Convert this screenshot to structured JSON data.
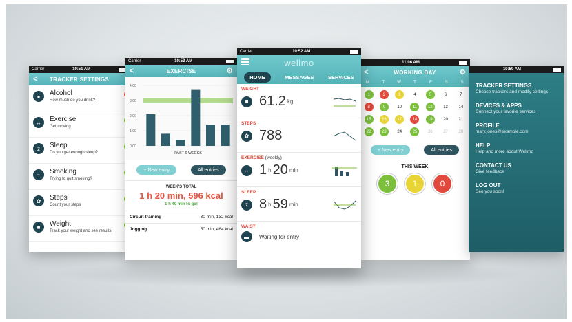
{
  "phone1": {
    "carrier": "Carrier",
    "time": "10:51 AM",
    "title": "TRACKER SETTINGS",
    "back": "<",
    "items": [
      {
        "icon": "alcohol-icon",
        "glyph": "●",
        "name": "Alcohol",
        "sub": "How much do you drink?",
        "toggle": "#e0493b"
      },
      {
        "icon": "exercise-icon",
        "glyph": "↔",
        "name": "Exercise",
        "sub": "Get moving",
        "toggle": "#7cbf3c"
      },
      {
        "icon": "sleep-icon",
        "glyph": "z",
        "name": "Sleep",
        "sub": "Do you get enough sleep?",
        "toggle": "#7cbf3c"
      },
      {
        "icon": "smoking-icon",
        "glyph": "~",
        "name": "Smoking",
        "sub": "Trying to quit smoking?",
        "toggle": "#7cbf3c"
      },
      {
        "icon": "steps-icon",
        "glyph": "✿",
        "name": "Steps",
        "sub": "Count your steps",
        "toggle": "#7cbf3c"
      },
      {
        "icon": "weight-icon",
        "glyph": "■",
        "name": "Weight",
        "sub": "Track your weight and see results!",
        "toggle": "#7cbf3c"
      }
    ]
  },
  "phone2": {
    "carrier": "Carrier",
    "time": "10:53 AM",
    "title": "EXERCISE",
    "chart_caption": "PAST 6 WEEKS",
    "new_entry": "+  New entry",
    "all_entries": "All entries",
    "weeks_total_label": "WEEK'S TOTAL",
    "weeks_total_value": "1 h 20 min, 596 kcal",
    "to_go": "1 h 40 min to go!",
    "entries": [
      {
        "name": "Circuit training",
        "value": "30 min, 132 kcal"
      },
      {
        "name": "Jogging",
        "value": "50 min, 464 kcal"
      }
    ]
  },
  "chart_data": {
    "type": "bar",
    "categories": [
      "1",
      "2",
      "3",
      "4",
      "5",
      "6"
    ],
    "values": [
      2.1,
      0.8,
      0.4,
      3.7,
      1.4,
      1.4
    ],
    "ylim": [
      0,
      4
    ],
    "yticks": [
      "4:00",
      "3:00",
      "2:00",
      "1:00",
      "0:00"
    ],
    "target": 3,
    "title": "",
    "xlabel": "PAST 6 WEEKS",
    "ylabel": ""
  },
  "phone3": {
    "carrier": "Carrier",
    "time": "10:52 AM",
    "logo": "wellmo",
    "tabs": [
      "HOME",
      "MESSAGES",
      "SERVICES"
    ],
    "metrics": [
      {
        "label": "WEIGHT",
        "icon": "weight-icon",
        "glyph": "■",
        "value": "61.2",
        "unit": "kg"
      },
      {
        "label": "STEPS",
        "icon": "steps-icon",
        "glyph": "✿",
        "value": "788",
        "unit": ""
      },
      {
        "label": "EXERCISE",
        "label2": "(weekly)",
        "icon": "exercise-icon",
        "glyph": "↔",
        "value": "1",
        "unit": "h",
        "value2": "20",
        "unit2": "min"
      },
      {
        "label": "SLEEP",
        "icon": "sleep-icon",
        "glyph": "z",
        "value": "8",
        "unit": "h",
        "value2": "59",
        "unit2": "min"
      }
    ],
    "waist_label": "WAIST",
    "waist_status": "Waiting for entry"
  },
  "phone4": {
    "time": "11:06 AM",
    "title": "WORKING DAY",
    "back": "<",
    "dow": [
      "M",
      "T",
      "W",
      "T",
      "F",
      "S",
      "S"
    ],
    "days": [
      {
        "d": "1",
        "c": "g"
      },
      {
        "d": "2",
        "c": "r"
      },
      {
        "d": "3",
        "c": "y"
      },
      {
        "d": "4",
        "c": ""
      },
      {
        "d": "5",
        "c": "g"
      },
      {
        "d": "6",
        "c": ""
      },
      {
        "d": "7",
        "c": ""
      },
      {
        "d": "8",
        "c": "r"
      },
      {
        "d": "9",
        "c": "g"
      },
      {
        "d": "10",
        "c": ""
      },
      {
        "d": "11",
        "c": "g"
      },
      {
        "d": "12",
        "c": "g"
      },
      {
        "d": "13",
        "c": ""
      },
      {
        "d": "14",
        "c": ""
      },
      {
        "d": "15",
        "c": "g"
      },
      {
        "d": "16",
        "c": "y"
      },
      {
        "d": "17",
        "c": "y"
      },
      {
        "d": "18",
        "c": "r"
      },
      {
        "d": "19",
        "c": "g"
      },
      {
        "d": "20",
        "c": ""
      },
      {
        "d": "21",
        "c": ""
      },
      {
        "d": "22",
        "c": "g"
      },
      {
        "d": "23",
        "c": "g"
      },
      {
        "d": "24",
        "c": ""
      },
      {
        "d": "25",
        "c": "g"
      },
      {
        "d": "26",
        "c": "fut"
      },
      {
        "d": "27",
        "c": "fut"
      },
      {
        "d": "28",
        "c": "fut"
      }
    ],
    "new_entry": "+  New entry",
    "all_entries": "All entries",
    "this_week": "THIS WEEK",
    "week_counts": [
      {
        "value": "3",
        "color": "#7cbf3c"
      },
      {
        "value": "1",
        "color": "#e8d436"
      },
      {
        "value": "0",
        "color": "#e0493b"
      }
    ]
  },
  "phone5": {
    "time": "10:59 AM",
    "items": [
      {
        "title": "TRACKER SETTINGS",
        "sub": "Choose trackers and modify settings"
      },
      {
        "title": "DEVICES & APPS",
        "sub": "Connect your favorite services"
      },
      {
        "title": "PROFILE",
        "sub": "mary.jones@example.com"
      },
      {
        "title": "HELP",
        "sub": "Help and more about Wellmo"
      },
      {
        "title": "CONTACT US",
        "sub": "Give feedback"
      },
      {
        "title": "LOG OUT",
        "sub": "See you soon!"
      }
    ]
  }
}
